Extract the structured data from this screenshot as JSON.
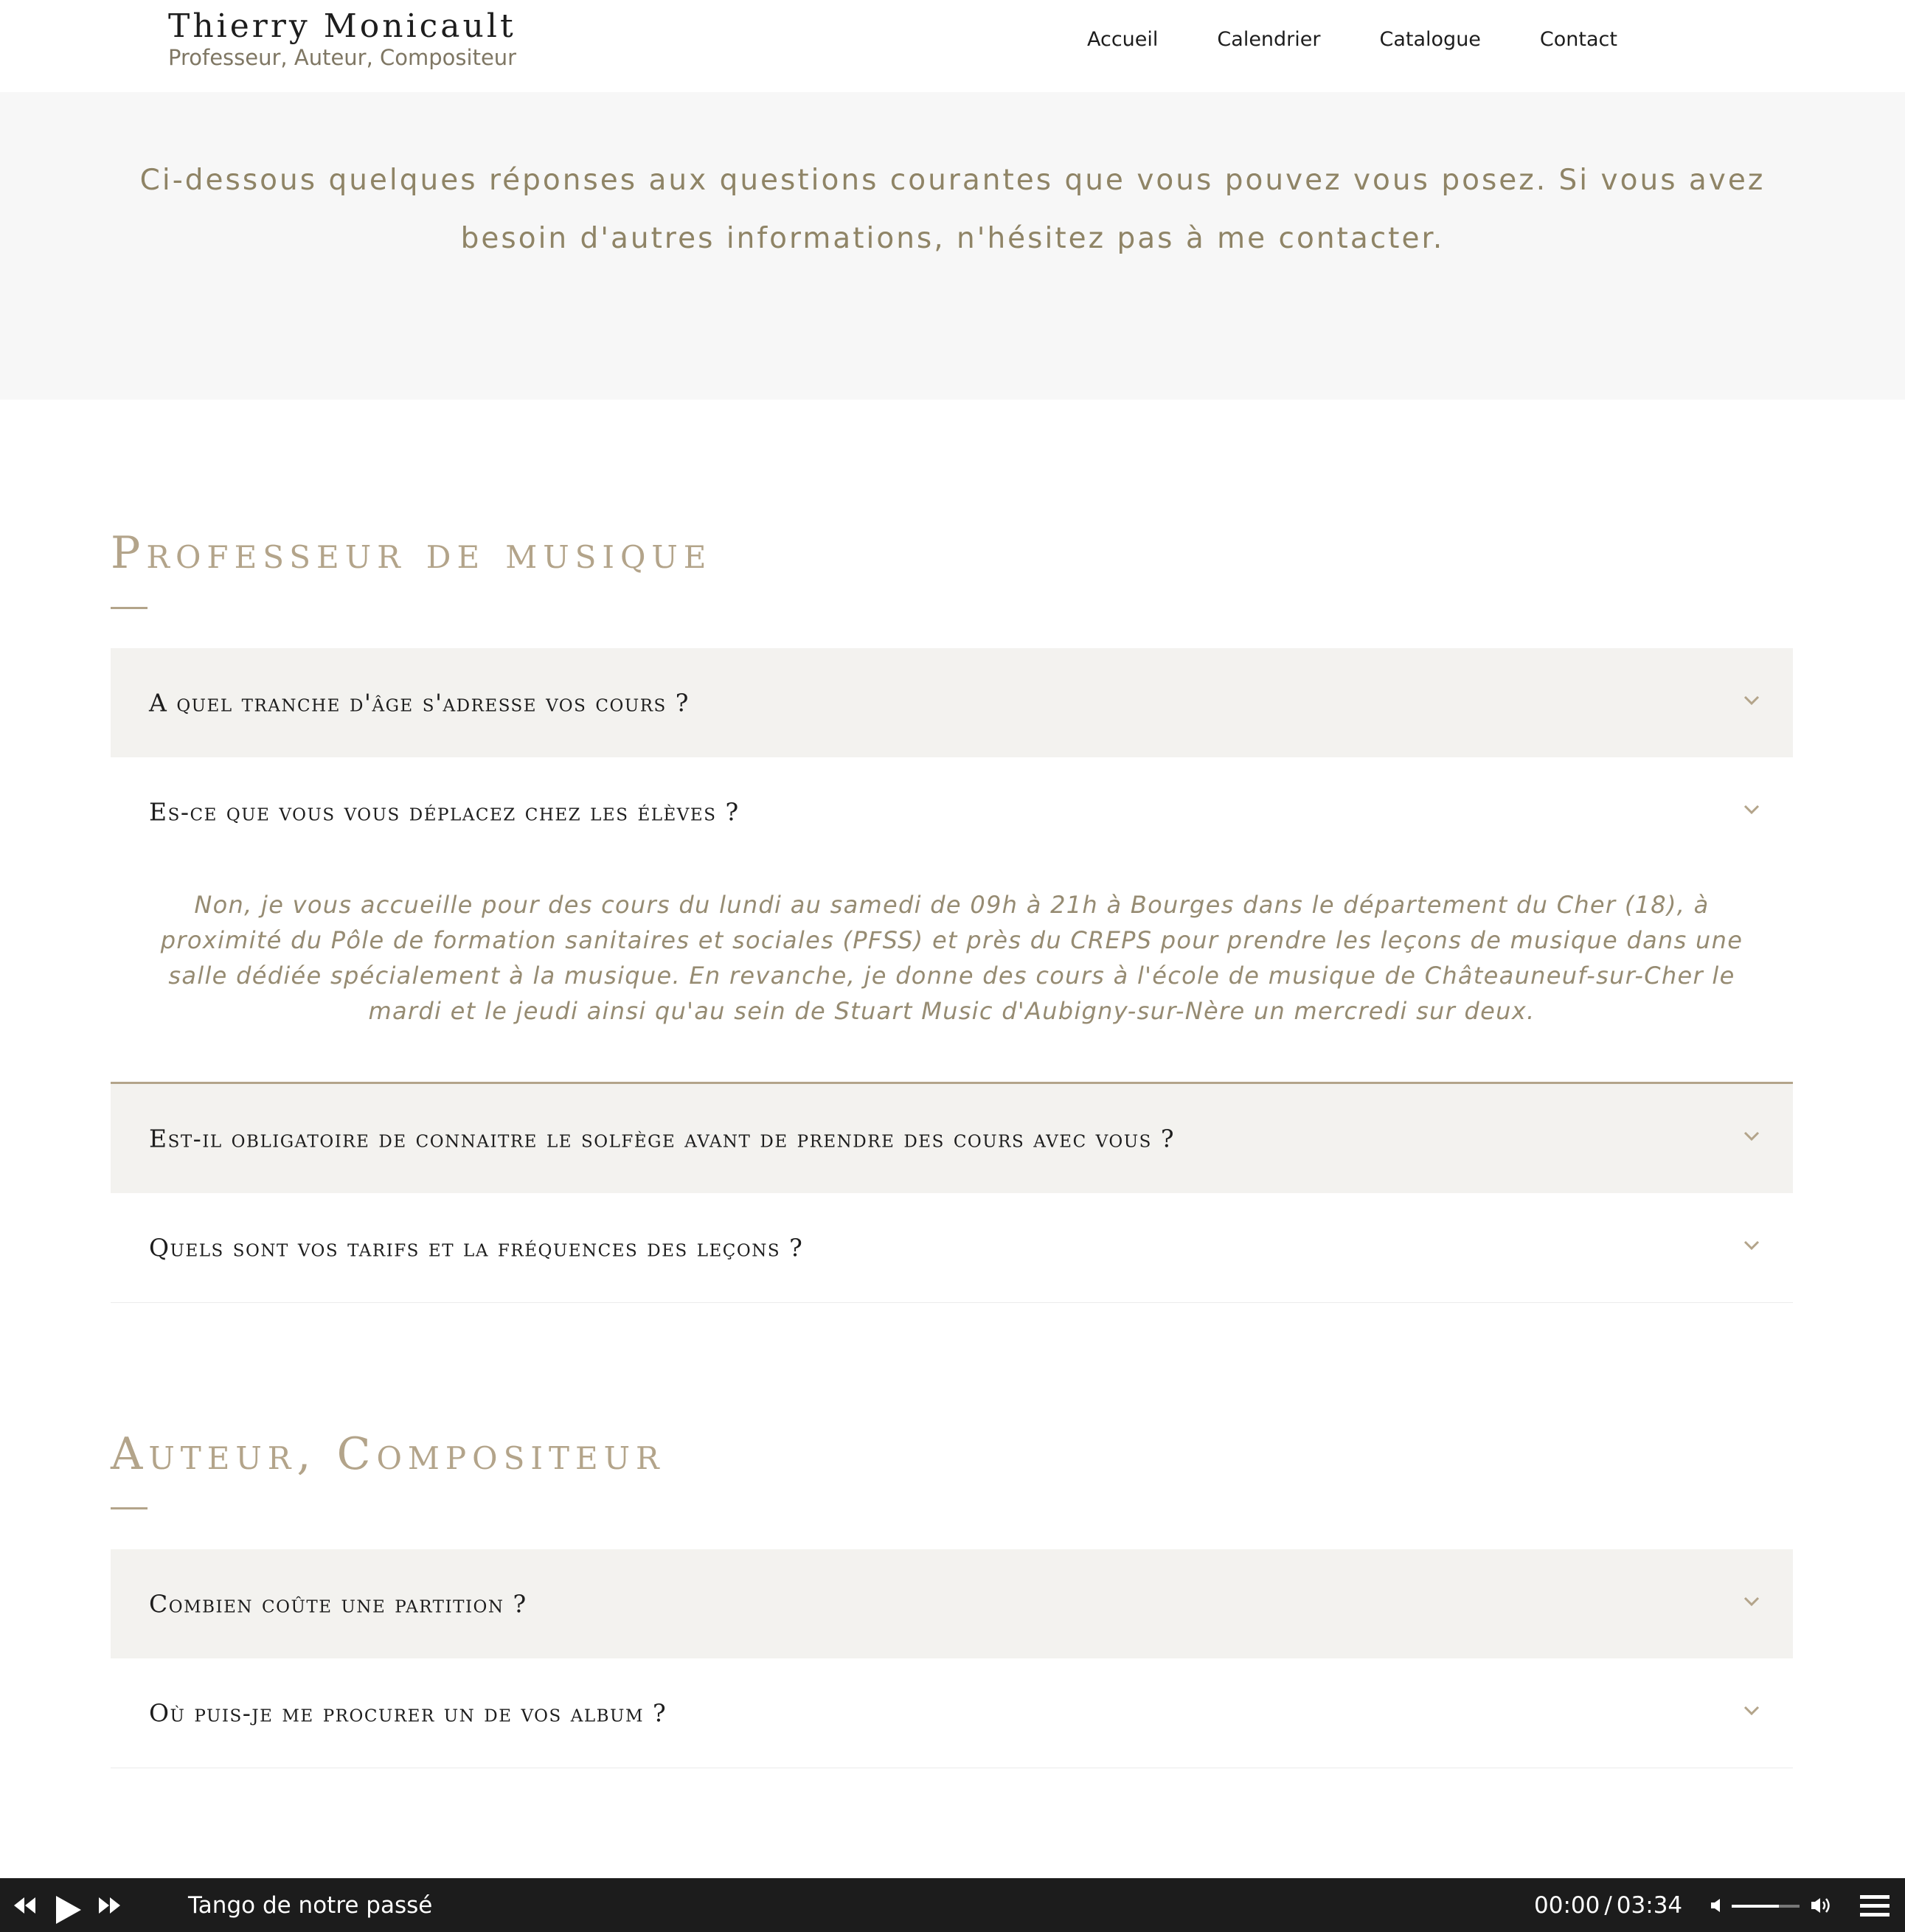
{
  "header": {
    "site_name": "Thierry Monicault",
    "tagline": "Professeur, Auteur, Compositeur",
    "nav": [
      "Accueil",
      "Calendrier",
      "Catalogue",
      "Contact"
    ]
  },
  "intro": {
    "text": "Ci-dessous quelques réponses aux questions courantes que vous pouvez vous posez. Si vous avez besoin d'autres informations, n'hésitez pas à me contacter."
  },
  "sections": [
    {
      "title": "Professeur de musique",
      "items": [
        {
          "question": "A quel tranche d'âge s'adresse vos cours ?",
          "expanded": false
        },
        {
          "question": "Es-ce que vous vous déplacez chez les élèves ?",
          "expanded": true,
          "answer": "Non, je vous accueille pour des cours du lundi au samedi de 09h à 21h à Bourges dans le département du Cher (18), à proximité du Pôle de formation sanitaires et sociales (PFSS) et près du CREPS pour prendre les leçons de musique dans une salle dédiée spécialement à la musique.  En revanche, je donne des cours à l'école de musique de Châteauneuf-sur-Cher le mardi et le jeudi ainsi qu'au sein de Stuart Music d'Aubigny-sur-Nère un mercredi sur deux."
        },
        {
          "question": "Est-il obligatoire de connaitre le solfège avant de prendre des cours avec vous ?",
          "expanded": false
        },
        {
          "question": "Quels sont vos tarifs et la fréquences des leçons ?",
          "expanded": false
        }
      ]
    },
    {
      "title": "Auteur, Compositeur",
      "items": [
        {
          "question": "Combien coûte une partition ?",
          "expanded": false
        },
        {
          "question": "Où puis-je me procurer un de vos album ?",
          "expanded": false
        }
      ]
    }
  ],
  "player": {
    "track_title": "Tango de notre passé",
    "current_time": "00:00",
    "separator": "/",
    "duration": "03:34",
    "volume_fraction": 0.7,
    "icons": [
      "previous-icon",
      "play-icon",
      "next-icon",
      "volume-low-icon",
      "volume-high-icon",
      "playlist-menu-icon"
    ]
  },
  "colors": {
    "accent": "#b3a48a",
    "intro_text": "#8f8466",
    "player_bg": "#1c1c1c",
    "shaded_row": "#f3f2ef"
  }
}
